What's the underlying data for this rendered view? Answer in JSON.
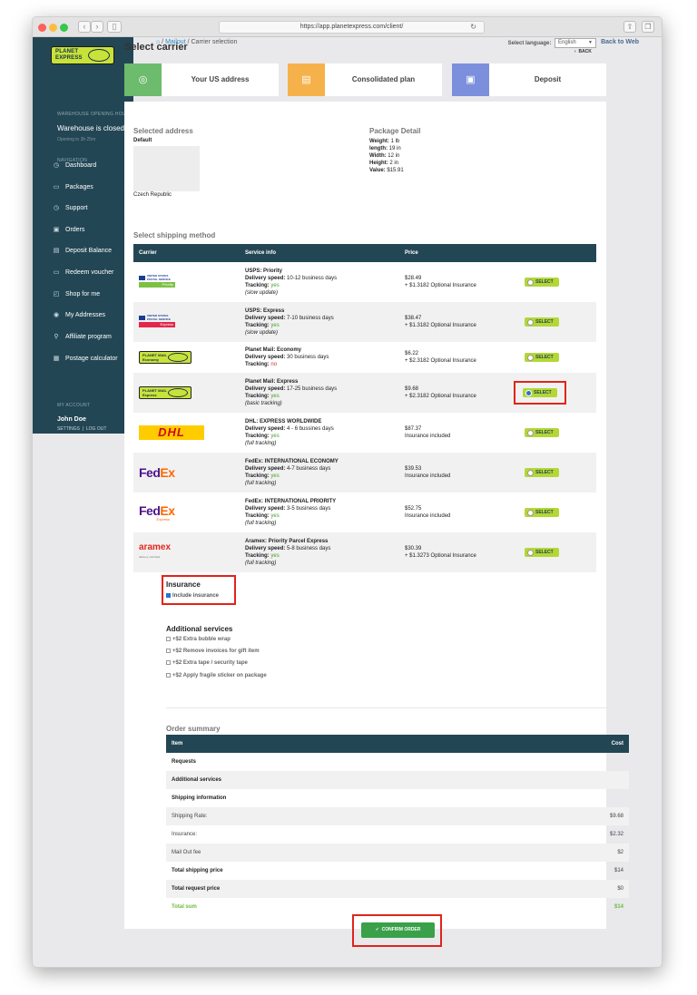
{
  "browser": {
    "url": "https://app.planetexpress.com/client/"
  },
  "sidebar": {
    "logo_line1": "PLANET",
    "logo_line2": "EXPRESS",
    "warehouse_heading": "WAREHOUSE OPENING HOURS",
    "warehouse_status": "Warehouse is closed",
    "warehouse_opening": "Opening in 3h 25m",
    "nav_heading": "NAVIGATION",
    "items": [
      {
        "label": "Dashboard",
        "icon": "dashboard-icon",
        "glyph": "◷"
      },
      {
        "label": "Packages",
        "icon": "package-icon",
        "glyph": "▭",
        "chevron": true
      },
      {
        "label": "Support",
        "icon": "support-icon",
        "glyph": "◷",
        "chevron": true
      },
      {
        "label": "Orders",
        "icon": "orders-icon",
        "glyph": "▣"
      },
      {
        "label": "Deposit Balance",
        "icon": "deposit-icon",
        "glyph": "▤"
      },
      {
        "label": "Redeem voucher",
        "icon": "voucher-icon",
        "glyph": "▭"
      },
      {
        "label": "Shop for me",
        "icon": "bag-icon",
        "glyph": "◰"
      },
      {
        "label": "My Addresses",
        "icon": "location-icon",
        "glyph": "◉"
      },
      {
        "label": "Affiliate program",
        "icon": "affiliate-icon",
        "glyph": "⚲",
        "chevron": true
      },
      {
        "label": "Postage calculator",
        "icon": "calculator-icon",
        "glyph": "▦"
      }
    ],
    "account_heading": "MY ACCOUNT",
    "account_name": "John Doe",
    "settings": "SETTINGS",
    "logout": "LOG OUT"
  },
  "topbar": {
    "crumb_link": "Mailout",
    "crumb_current": "/ Carrier selection",
    "language_label": "Select language:",
    "language_value": "English",
    "back_to_web": "Back to Web"
  },
  "page": {
    "title": "Select carrier",
    "back": "BACK"
  },
  "steps": [
    {
      "label": "Your US address",
      "color": "#6dbb6d",
      "icon": "pin-icon",
      "glyph": "◎"
    },
    {
      "label": "Consolidated plan",
      "color": "#f6b24a",
      "icon": "clipboard-icon",
      "glyph": "▤"
    },
    {
      "label": "Deposit",
      "color": "#7b8fdc",
      "icon": "deposit-icon",
      "glyph": "▣"
    }
  ],
  "address": {
    "heading": "Selected address",
    "name": "Default",
    "country": "Czech Republic"
  },
  "package": {
    "heading": "Package Detail",
    "lines": [
      {
        "k": "Weight:",
        "v": "1 lb"
      },
      {
        "k": "length:",
        "v": "19 in"
      },
      {
        "k": "Width:",
        "v": "12 in"
      },
      {
        "k": "Height:",
        "v": "2 in"
      },
      {
        "k": "Value:",
        "v": "$15.91"
      }
    ]
  },
  "shipping": {
    "heading": "Select shipping method",
    "columns": [
      "Carrier",
      "Service info",
      "Price",
      ""
    ],
    "select_label": "SELECT",
    "speed_label": "Delivery speed:",
    "tracking_label": "Tracking:",
    "rows": [
      {
        "logo": "usps",
        "bar": "Priority",
        "bar_color": "#7cc142",
        "name": "USPS: Priority",
        "speed": "10-12 business days",
        "tracking": "yes",
        "note": "(slow update)",
        "price": "$28.49",
        "extra": "+ $1.3182 Optional Insurance",
        "selected": false
      },
      {
        "logo": "usps",
        "bar": "Express",
        "bar_color": "#e3264b",
        "name": "USPS: Express",
        "speed": "7-10 business days",
        "tracking": "yes",
        "note": "(slow update)",
        "price": "$38.47",
        "extra": "+ $1.3182 Optional Insurance",
        "selected": false
      },
      {
        "logo": "pm",
        "bar": "Economy",
        "name": "Planet Mail: Economy",
        "speed": "30 business days",
        "tracking": "no",
        "note": "",
        "price": "$6.22",
        "extra": "+ $2.3182 Optional Insurance",
        "selected": false
      },
      {
        "logo": "pm",
        "bar": "Express",
        "name": "Planet Mail: Express",
        "speed": "17-25 business days",
        "tracking": "yes",
        "note": "(basic tracking)",
        "price": "$9.68",
        "extra": "+ $2.3182 Optional Insurance",
        "selected": true
      },
      {
        "logo": "dhl",
        "name": "DHL: EXPRESS WORLDWIDE",
        "speed": "4 - 6 bussines days",
        "tracking": "yes",
        "note": "(full tracking)",
        "price": "$87.37",
        "extra": "Insurance included",
        "selected": false
      },
      {
        "logo": "fedex",
        "name": "FedEx: INTERNATIONAL ECONOMY",
        "speed": "4-7 business days",
        "tracking": "yes",
        "note": "(full tracking)",
        "price": "$39.53",
        "extra": "Insurance included",
        "selected": false
      },
      {
        "logo": "fedex-express",
        "name": "FedEx: INTERNATIONAL PRIORITY",
        "speed": "3-5 business days",
        "tracking": "yes",
        "note": "(full tracking)",
        "price": "$52.75",
        "extra": "Insurance included",
        "selected": false
      },
      {
        "logo": "aramex",
        "name": "Aramex: Priority Parcel Express",
        "speed": "5-8 business days",
        "tracking": "yes",
        "note": "(full tracking)",
        "price": "$30.39",
        "extra": "+ $1.3273 Optional Insurance",
        "selected": false
      }
    ],
    "logo_text": {
      "usps": "UNITED STATES POSTAL SERVICE",
      "pm_line1": "PLANET MAIL",
      "dhl": "DHL",
      "fedex_fed": "Fed",
      "fedex_ex": "Ex",
      "fedex_express": "Express",
      "aramex": "aramex",
      "aramex_sub": "delivery unlimited"
    }
  },
  "insurance": {
    "heading": "Insurance",
    "option": "Include insurance",
    "checked": true
  },
  "additional": {
    "heading": "Additional services",
    "options": [
      "+$2 Extra bubble wrap",
      "+$2 Remove invoices for gift item",
      "+$2 Extra tape / security tape",
      "+$2 Apply fragile sticker on package"
    ]
  },
  "summary": {
    "heading": "Order summary",
    "col_item": "Item",
    "col_cost": "Cost",
    "rows": [
      {
        "item": "Requests",
        "cost": "",
        "style": "b"
      },
      {
        "item": "Additional services",
        "cost": "",
        "style": "b"
      },
      {
        "item": "Shipping information",
        "cost": "",
        "style": "b"
      },
      {
        "item": "Shipping Rate:",
        "cost": "$9.68",
        "style": ""
      },
      {
        "item": "Insurance:",
        "cost": "$2.32",
        "style": ""
      },
      {
        "item": "Mail Out fee",
        "cost": "$2",
        "style": ""
      },
      {
        "item": "Total shipping price",
        "cost": "$14",
        "style": "b"
      },
      {
        "item": "Total request price",
        "cost": "$0",
        "style": "b"
      },
      {
        "item": "Total sum",
        "cost": "$14",
        "style": "g"
      }
    ]
  },
  "confirm_label": "CONFIRM ORDER"
}
